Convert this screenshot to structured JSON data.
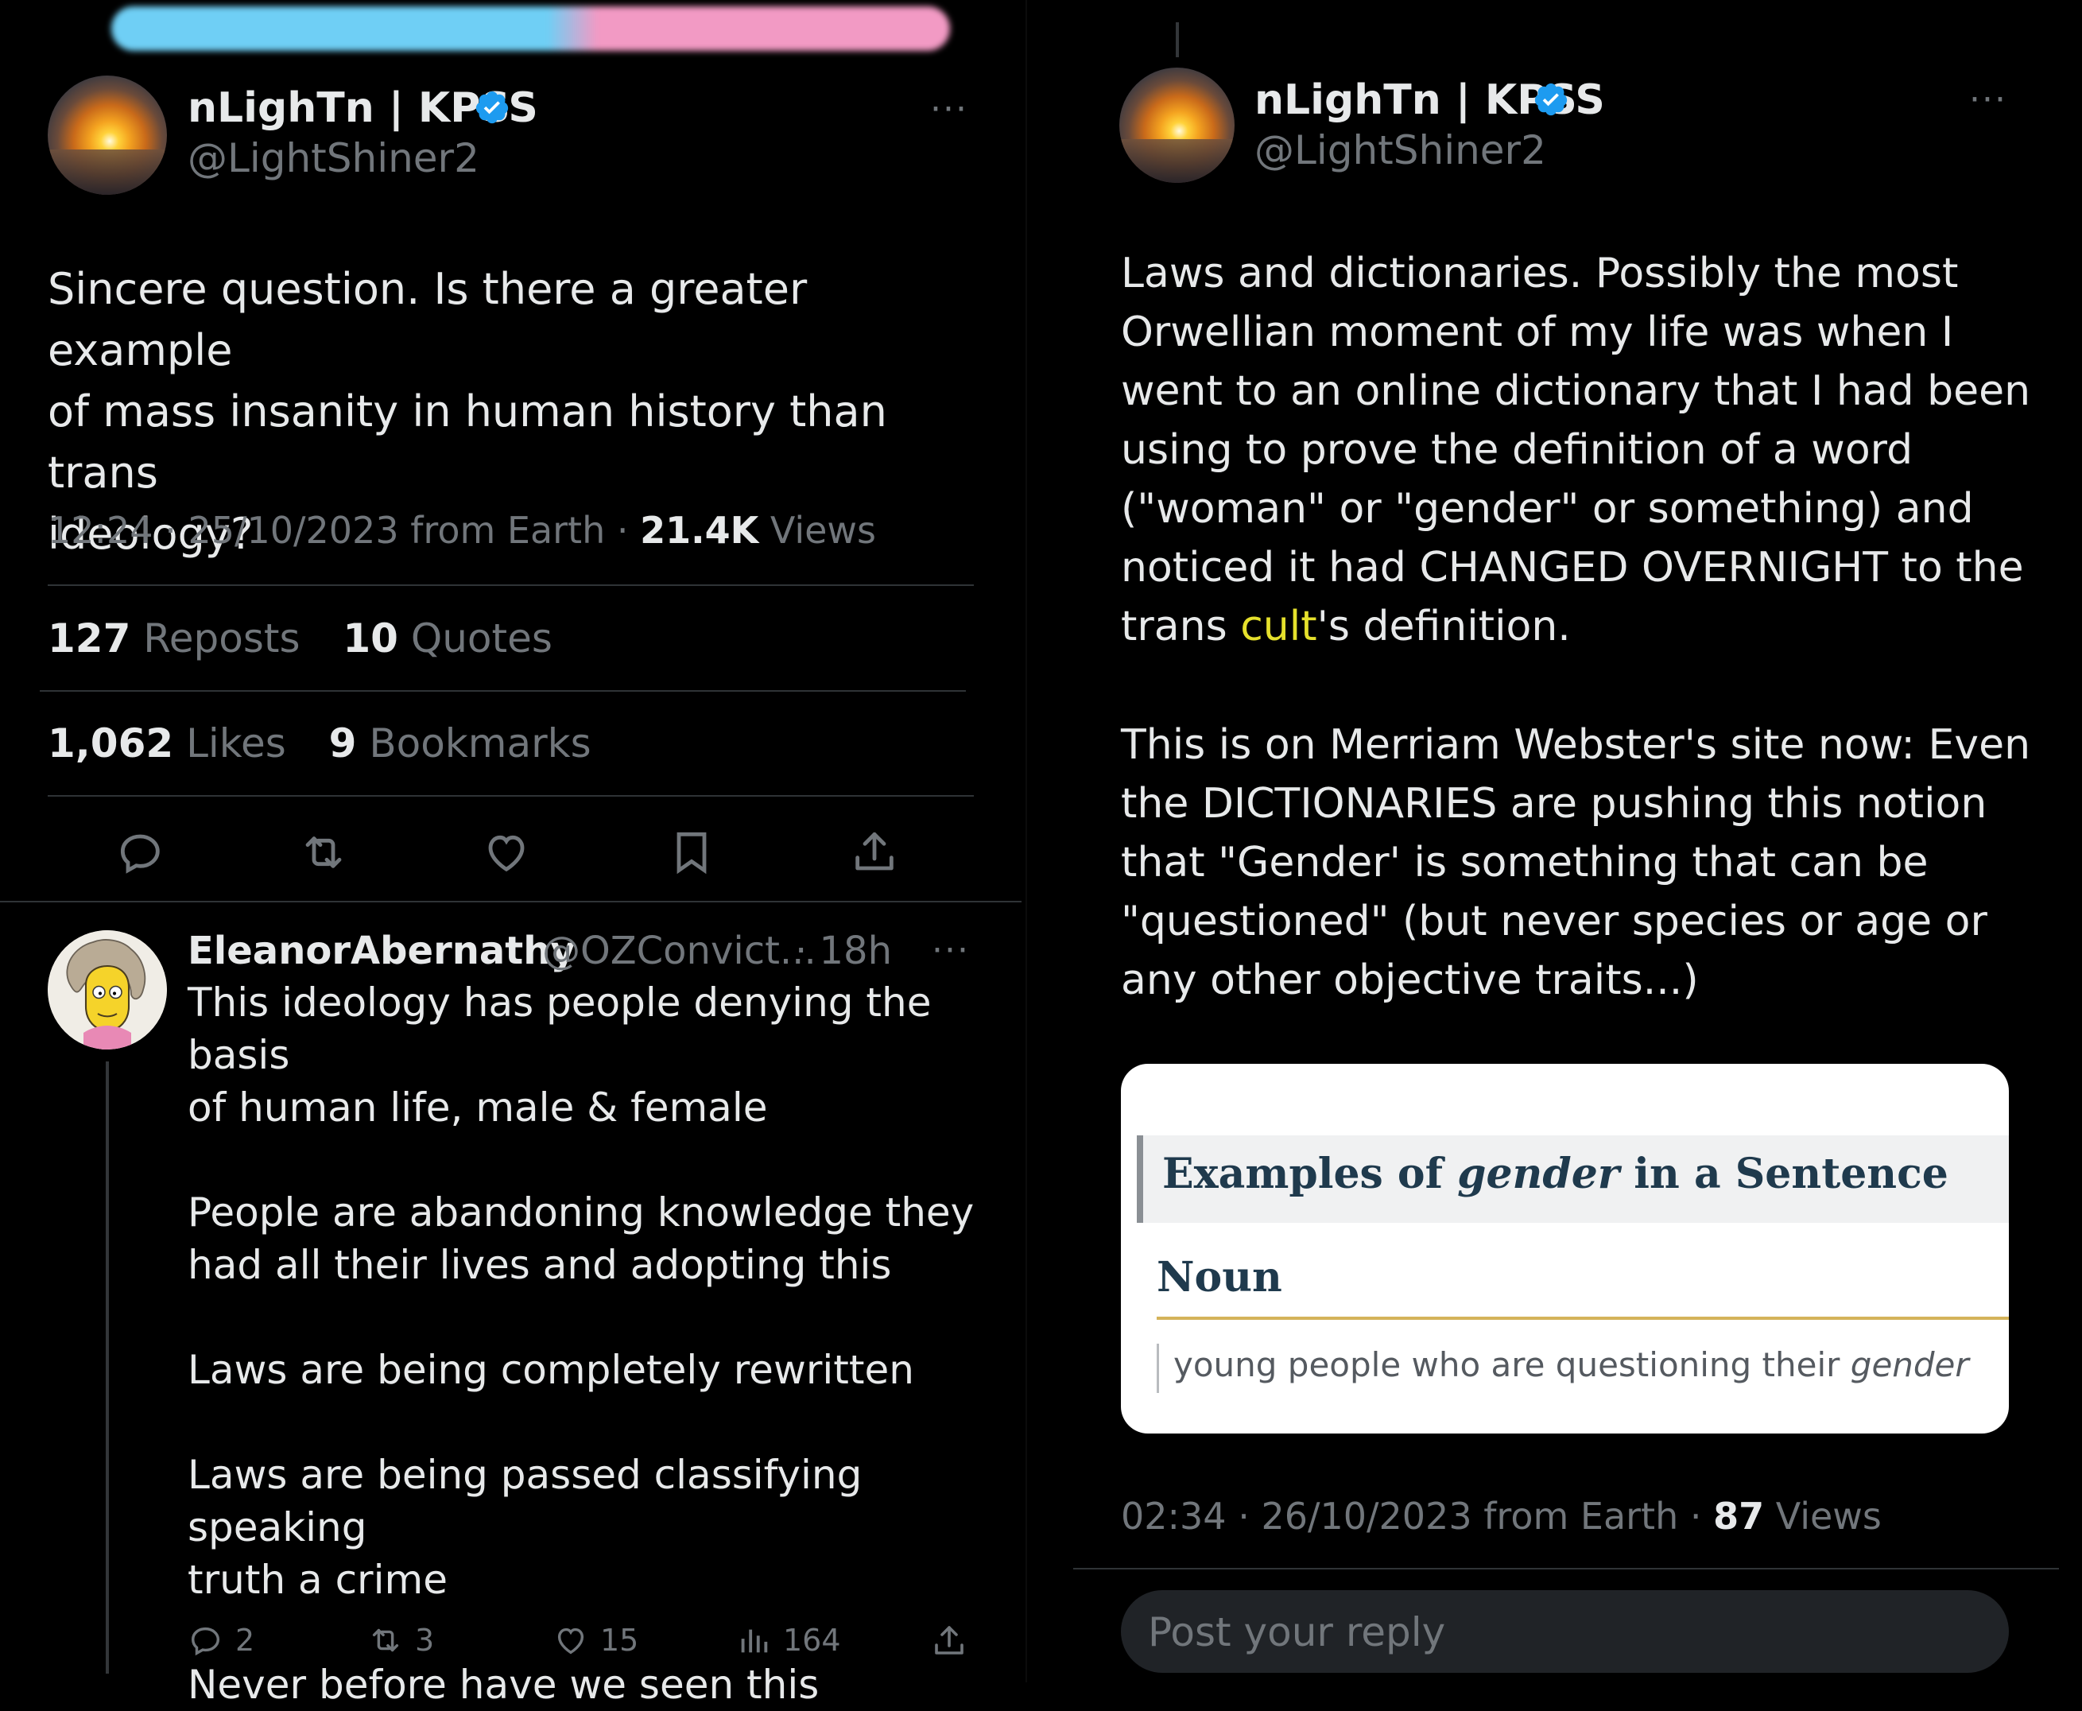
{
  "left": {
    "main_tweet": {
      "display_name": "nLighTn | KPSS",
      "handle": "@LightShiner2",
      "more": "···",
      "text": "Sincere question. Is there a greater example\nof mass insanity in human history than trans\nideology?",
      "time": "12:24",
      "date": "25/10/2023",
      "source": "from Earth",
      "views_count": "21.4K",
      "views_label": "Views",
      "reposts_count": "127",
      "reposts_label": "Reposts",
      "quotes_count": "10",
      "quotes_label": "Quotes",
      "likes_count": "1,062",
      "likes_label": "Likes",
      "bookmarks_count": "9",
      "bookmarks_label": "Bookmarks"
    },
    "reply": {
      "display_name": "EleanorAbernathy",
      "handle": "@OZConvict...",
      "age": "· 18h",
      "more": "···",
      "text": "This ideology has people denying the basis\nof human life, male & female\n\nPeople are abandoning knowledge they\nhad all their lives and adopting this\n\nLaws are being completely rewritten\n\nLaws are being passed classifying speaking\ntruth a crime\n\nNever before have we seen this",
      "replies": "2",
      "reposts": "3",
      "likes": "15",
      "views": "164"
    }
  },
  "right": {
    "tweet": {
      "display_name": "nLighTn | KPSS",
      "handle": "@LightShiner2",
      "more": "···",
      "para1_before": "Laws and dictionaries. Possibly the most\nOrwellian moment of my life was when I\nwent to an online dictionary that I had been\nusing to prove the definition of a word\n(\"woman\" or \"gender\" or something) and\nnoticed it had CHANGED OVERNIGHT to the\ntrans ",
      "para1_highlight": "cult",
      "para1_after": "'s definition.",
      "para2": "This is on Merriam Webster's site now: Even\nthe DICTIONARIES are pushing this notion\nthat \"Gender' is something that can be\n\"questioned\" (but never species or age or\nany other objective traits...)",
      "card": {
        "heading_prefix": "Examples of ",
        "heading_word": "gender",
        "heading_suffix": " in a Sentence",
        "section": "Noun",
        "example_prefix": "young people who are questioning their ",
        "example_word": "gender"
      },
      "time": "02:34",
      "date": "26/10/2023",
      "source": "from Earth",
      "views_count": "87",
      "views_label": "Views"
    },
    "reply_box": {
      "placeholder": "Post your reply"
    }
  },
  "colors": {
    "background": "#000000",
    "text": "#e7e9ea",
    "muted": "#71767b",
    "divider": "#2f3336",
    "verified": "#1d9bf0",
    "highlight": "#e5e02c",
    "card_heading": "#1f3a4d",
    "card_rule": "#d4b35a"
  }
}
